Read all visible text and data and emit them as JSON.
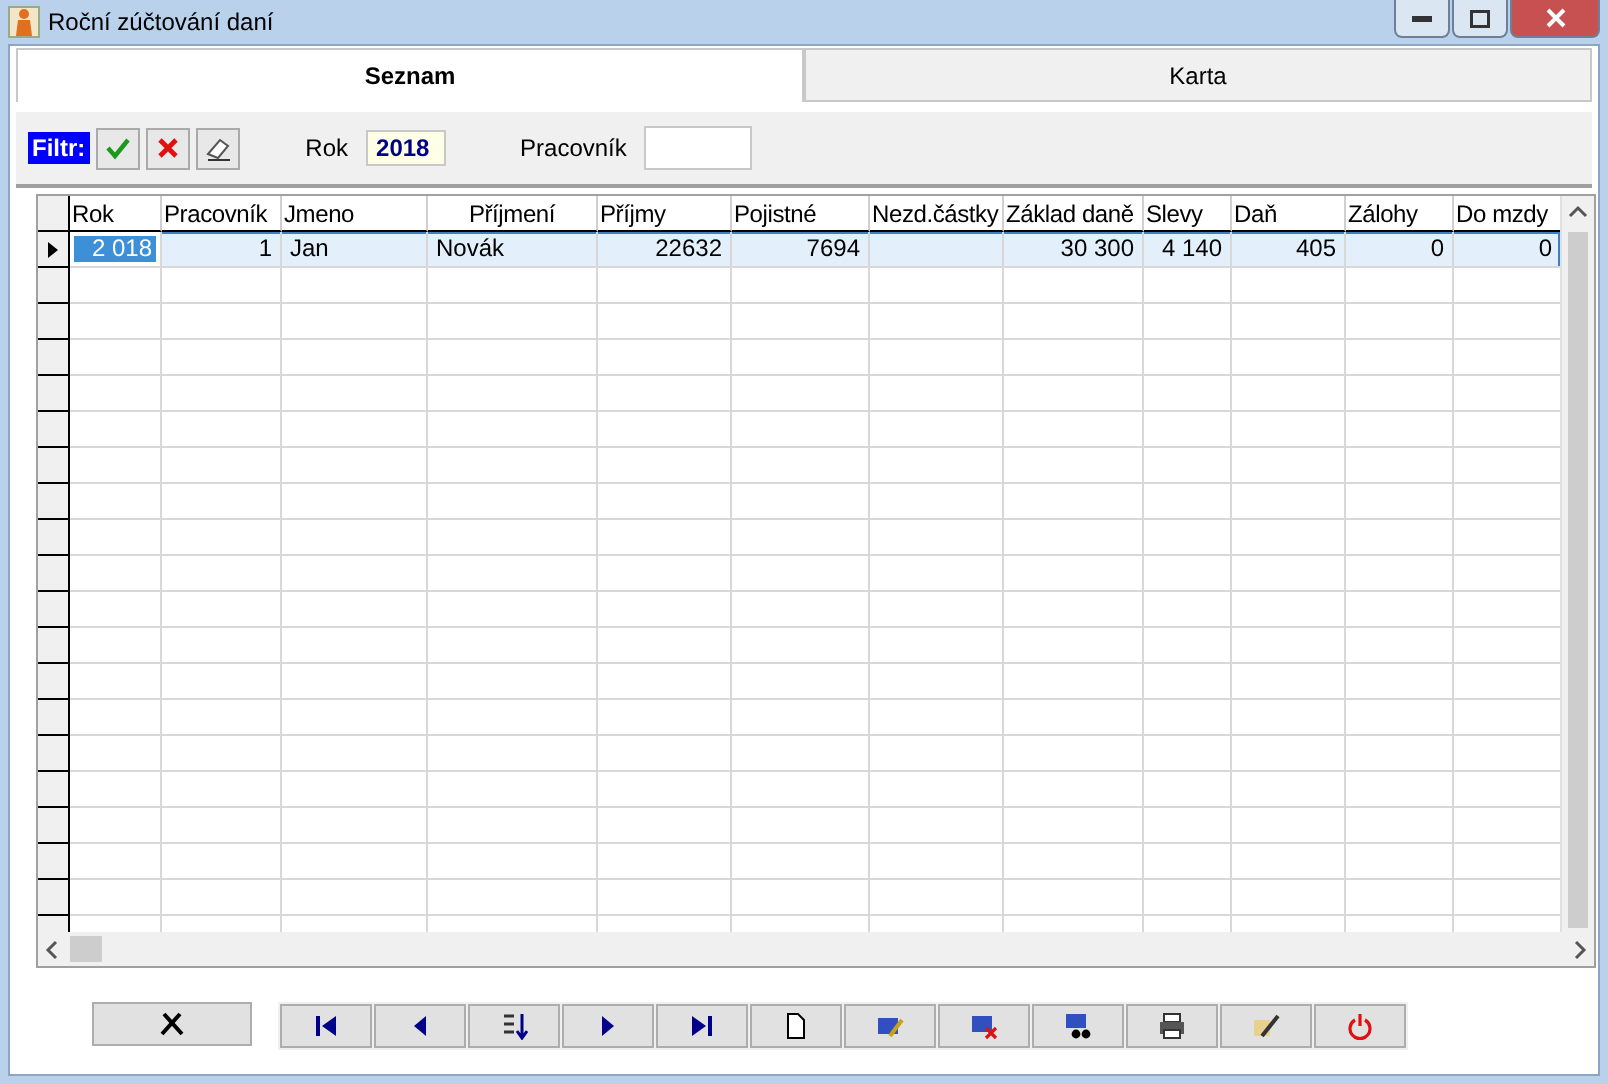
{
  "window": {
    "title": "Roční zúčtování daní"
  },
  "tabs": [
    {
      "label": "Seznam",
      "selected": true
    },
    {
      "label": "Karta",
      "selected": false
    }
  ],
  "filter": {
    "label": "Filtr:",
    "rok_label": "Rok",
    "rok_value": "2018",
    "pracovnik_label": "Pracovník"
  },
  "table": {
    "columns": [
      {
        "label": "Rok",
        "kind": "number"
      },
      {
        "label": "Pracovník",
        "kind": "number"
      },
      {
        "label": "Jmeno",
        "kind": "text"
      },
      {
        "label": "Příjmení",
        "kind": "text"
      },
      {
        "label": "Příjmy",
        "kind": "number"
      },
      {
        "label": "Pojistné",
        "kind": "number"
      },
      {
        "label": "Nezd.částky",
        "kind": "number"
      },
      {
        "label": "Základ daně",
        "kind": "number"
      },
      {
        "label": "Slevy",
        "kind": "number"
      },
      {
        "label": "Daň",
        "kind": "number"
      },
      {
        "label": "Zálohy",
        "kind": "number"
      },
      {
        "label": "Do mzdy",
        "kind": "number"
      }
    ],
    "rows": [
      {
        "selected": true,
        "cells": [
          {
            "text": "2 018",
            "focused": true
          },
          {
            "text": "1",
            "focused": false
          },
          {
            "text": "Jan",
            "focused": false
          },
          {
            "text": "Novák",
            "focused": false
          },
          {
            "text": "22632",
            "focused": false
          },
          {
            "text": "7694",
            "focused": false
          },
          {
            "text": "",
            "focused": false
          },
          {
            "text": "30 300",
            "focused": false
          },
          {
            "text": "4 140",
            "focused": false
          },
          {
            "text": "405",
            "focused": false
          },
          {
            "text": "0",
            "focused": false
          },
          {
            "text": "0",
            "focused": false
          }
        ]
      }
    ]
  }
}
